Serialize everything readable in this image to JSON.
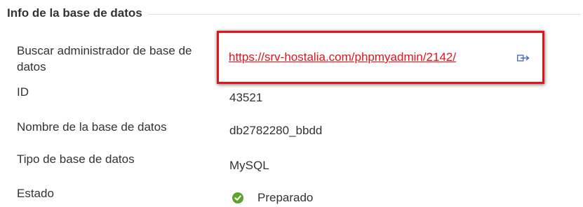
{
  "section": {
    "title": "Info de la base de datos"
  },
  "fields": {
    "admin_label": "Buscar administrador de base de datos",
    "admin_link": "https://srv-hostalia.com/phpmyadmin/2142/",
    "id_label": "ID",
    "id_value": "43521",
    "name_label": "Nombre de la base de datos",
    "name_value": "db2782280_bbdd",
    "type_label": "Tipo de base de datos",
    "type_value": "MySQL",
    "status_label": "Estado",
    "status_value": "Preparado"
  },
  "icons": {
    "link": "external-link-icon",
    "status": "check-circle-icon"
  },
  "colors": {
    "link": "#e3131b",
    "highlight_border": "#e3131b",
    "status_ok": "#5aa52c",
    "text": "#333333"
  }
}
